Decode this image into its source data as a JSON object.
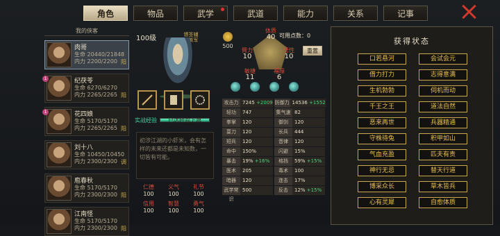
{
  "tabs": [
    "角色",
    "物品",
    "武学",
    "武道",
    "能力",
    "关系",
    "记事"
  ],
  "sidebar": {
    "title": "我的侠客",
    "heroes": [
      {
        "name": "肉哥",
        "hp": "生命 20440/21848",
        "mp": "内力 2200/2200",
        "mark": "阳"
      },
      {
        "name": "纪茯苓",
        "hp": "生命 6270/6270",
        "mp": "内力 2265/2265",
        "mark": "阳",
        "badge": "1"
      },
      {
        "name": "花四娘",
        "hp": "生命 5170/5170",
        "mp": "内力 2265/2265",
        "mark": "阳",
        "badge": "1"
      },
      {
        "name": "刘十八",
        "hp": "生命 10450/10450",
        "mp": "内力 2300/2300",
        "mark": "调"
      },
      {
        "name": "庖春秋",
        "hp": "生命 5170/5170",
        "mp": "内力 2300/2300",
        "mark": "阳"
      },
      {
        "name": "江南怪",
        "hp": "生命 5170/5170",
        "mp": "内力 2300/2300",
        "mark": "阳"
      }
    ]
  },
  "char": {
    "level": "100级",
    "title": "镖圣辅 叶紫军",
    "money": "500",
    "attrs": {
      "tizhi": "体质",
      "tizhi_v": "40",
      "binli": "臂力",
      "binli_v": "10",
      "wuxing": "悟性",
      "wuxing_v": "10",
      "minjie": "敏捷",
      "minjie_v": "11",
      "fuyuan": "福缘",
      "fuyuan_v": "6"
    },
    "points": "可用点数：0",
    "reset": "重置",
    "exp_label": "实战经验",
    "exp_text": "已达经验上限",
    "exp_fill": 1.0,
    "desc": "初涉江湖的小虾米，会有怎样的未来还都是未知数，一切皆有可能。",
    "virtues": [
      [
        "仁德",
        "100"
      ],
      [
        "义气",
        "100"
      ],
      [
        "礼节",
        "100"
      ],
      [
        "信用",
        "100"
      ],
      [
        "智慧",
        "100"
      ],
      [
        "勇气",
        "100"
      ]
    ],
    "stats": [
      [
        [
          "攻击力",
          "7245",
          "+2009"
        ],
        [
          "防御力",
          "14536",
          "+1552"
        ]
      ],
      [
        [
          "轻功",
          "747",
          ""
        ],
        [
          "集气速度",
          "82",
          ""
        ]
      ],
      [
        [
          "拳掌",
          "120",
          ""
        ],
        [
          "御剑",
          "120",
          ""
        ]
      ],
      [
        [
          "耍刀",
          "120",
          ""
        ],
        [
          "长兵",
          "444",
          ""
        ]
      ],
      [
        [
          "短兵",
          "120",
          ""
        ],
        [
          "音律",
          "120",
          ""
        ]
      ],
      [
        [
          "命中",
          "150%",
          ""
        ],
        [
          "闪避",
          "15%",
          ""
        ]
      ],
      [
        [
          "暴击",
          "19%",
          "+16%"
        ],
        [
          "格挡",
          "59%",
          "+15%"
        ]
      ],
      [
        [
          "医术",
          "205",
          ""
        ],
        [
          "毒术",
          "100",
          ""
        ]
      ],
      [
        [
          "暗器",
          "120",
          ""
        ],
        [
          "连击",
          "17%",
          ""
        ]
      ],
      [
        [
          "武学常识",
          "500",
          ""
        ],
        [
          "反击",
          "12%",
          "+15%"
        ]
      ]
    ]
  },
  "status": {
    "title": "获得状态",
    "items": [
      "口若悬河",
      "会试会元",
      "借力打力",
      "志得意满",
      "生机勃勃",
      "伺机而动",
      "千王之王",
      "道法自然",
      "恶来再世",
      "兵器精通",
      "守株待兔",
      "积甲如山",
      "气血充盈",
      "匹夫有责",
      "神行无忌",
      "替天行道",
      "博采众长",
      "草木皆兵",
      "心有灵犀",
      "自愈体质"
    ]
  }
}
